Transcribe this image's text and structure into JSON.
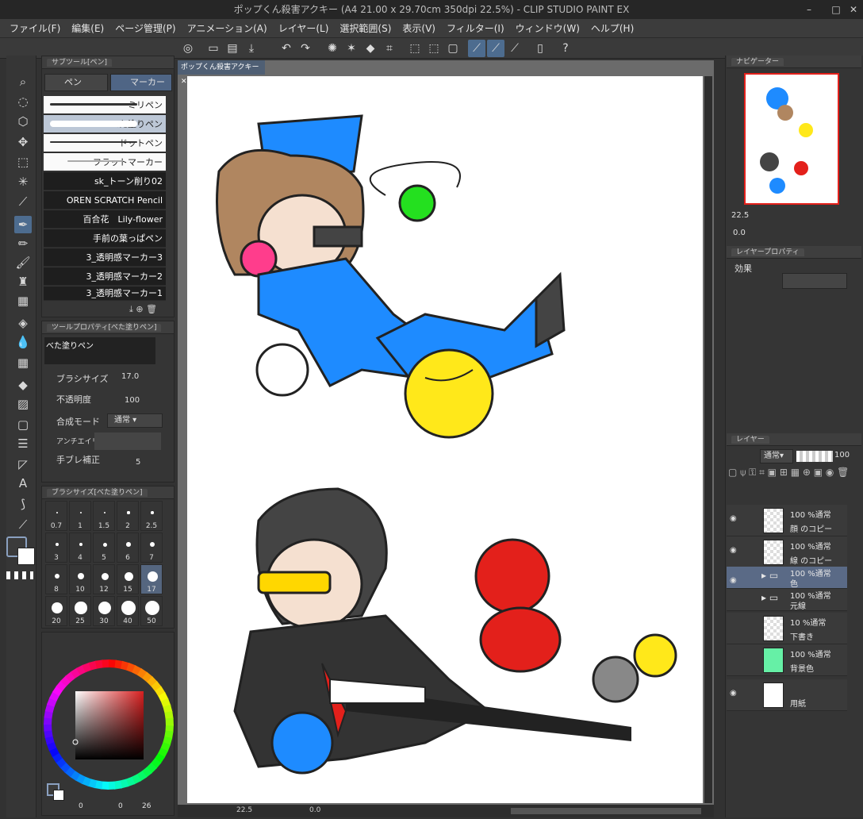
{
  "window": {
    "title": "ポップくん殺害アクキー (A4 21.00 x 29.70cm 350dpi 22.5%) - CLIP STUDIO PAINT EX"
  },
  "menu": [
    "ファイル(F)",
    "編集(E)",
    "ページ管理(P)",
    "アニメーション(A)",
    "レイヤー(L)",
    "選択範囲(S)",
    "表示(V)",
    "フィルター(I)",
    "ウィンドウ(W)",
    "ヘルプ(H)"
  ],
  "subtool": {
    "panel_title": "サブツール[ペン]",
    "tabs": [
      "ペン",
      "マーカー"
    ],
    "brushes": [
      "ミリペン",
      "べた塗りペン",
      "ドットペン",
      "フラットマーカー",
      "sk_トーン削り02",
      "OREN SCRATCH Pencil",
      "百合花　Lily-flower",
      "手前の葉っぱペン",
      "3_透明感マーカー3",
      "3_透明感マーカー2",
      "3_透明感マーカー1"
    ]
  },
  "toolprop": {
    "panel_title": "ツールプロパティ[べた塗りペン]",
    "preview_label": "べた塗りペン",
    "brush_size_label": "ブラシサイズ",
    "brush_size_value": "17.0",
    "opacity_label": "不透明度",
    "opacity_value": "100",
    "blend_label": "合成モード",
    "blend_value": "通常",
    "aa_label": "アンチエイリ",
    "stabilize_label": "手ブレ補正",
    "stabilize_value": "5"
  },
  "brushsize": {
    "panel_title": "ブラシサイズ[べた塗りペン]",
    "sizes": [
      "0.7",
      "1",
      "1.5",
      "2",
      "2.5",
      "3",
      "4",
      "5",
      "6",
      "7",
      "8",
      "10",
      "12",
      "15",
      "17",
      "20",
      "25",
      "30",
      "40",
      "50"
    ]
  },
  "color": {
    "bottom": [
      "0",
      "0",
      "26"
    ]
  },
  "document": {
    "tab_label": "ポップくん殺害アクキー"
  },
  "status": {
    "zoom": "22.5",
    "angle": "0.0"
  },
  "navigator": {
    "title": "ナビゲーター",
    "zoom": "22.5",
    "angle": "0.0"
  },
  "layerprop": {
    "title": "レイヤープロパティ",
    "effect_label": "効果"
  },
  "layers": {
    "title": "レイヤー",
    "blend": "通常",
    "opacity": "100",
    "items": [
      {
        "line1": "100 %通常",
        "line2": "顔 のコピー"
      },
      {
        "line1": "100 %通常",
        "line2": "線 のコピー"
      },
      {
        "line1": "100 %通常",
        "line2": "色"
      },
      {
        "line1": "100 %通常",
        "line2": "元線"
      },
      {
        "line1": "10 %通常",
        "line2": "下書き"
      },
      {
        "line1": "100 %通常",
        "line2": "背景色"
      },
      {
        "line1": "",
        "line2": "用紙"
      }
    ]
  },
  "colors": {
    "accent": "#4d6c8f",
    "bg": "#323232",
    "layer_sel": "#5a6a86",
    "bgcolor_thumb": "#66f0a6"
  }
}
